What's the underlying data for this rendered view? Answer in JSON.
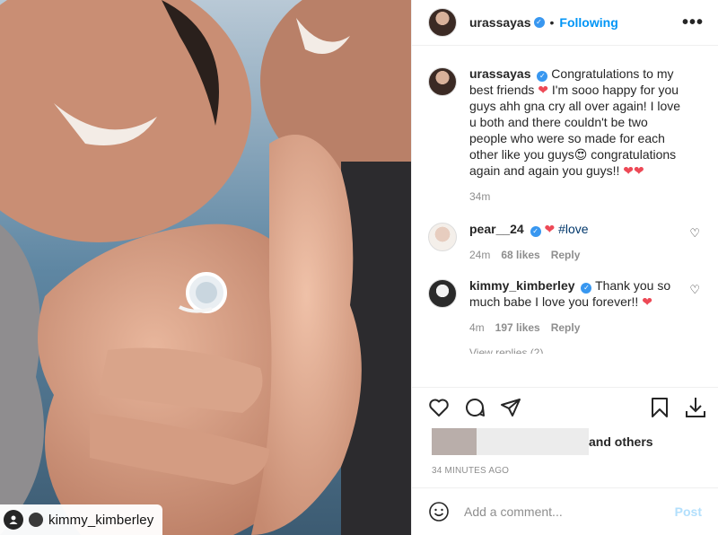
{
  "photo": {
    "tag_username": "kimmy_kimberley",
    "description_icon": "person-icon"
  },
  "header": {
    "username": "urassayas",
    "separator": "•",
    "follow_status": "Following",
    "more_icon": "•••"
  },
  "caption": {
    "username": "urassayas",
    "text_1": "Congratulations to my best friends",
    "text_2": "I'm sooo happy for you guys ahh gna cry all over again! I love u both and there couldn't be two people who were so made for each other like you guys",
    "text_3": "congratulations again and again you guys!!",
    "time": "34m"
  },
  "comments": [
    {
      "username": "pear__24",
      "text": "#love",
      "time": "24m",
      "likes": "68 likes",
      "reply": "Reply"
    },
    {
      "username": "kimmy_kimberley",
      "text": "Thank you so much babe I love you forever!!",
      "time": "4m",
      "likes": "197 likes",
      "reply": "Reply"
    }
  ],
  "view_replies": "View replies (2)",
  "likes_line": {
    "suffix": "and others"
  },
  "timestamp": "34 MINUTES AGO",
  "add_comment": {
    "placeholder": "Add a comment...",
    "post": "Post"
  },
  "colors": {
    "accent": "#0095f6",
    "heart": "#ed4956",
    "verified": "#3897f0",
    "muted": "#8e8e8e"
  }
}
